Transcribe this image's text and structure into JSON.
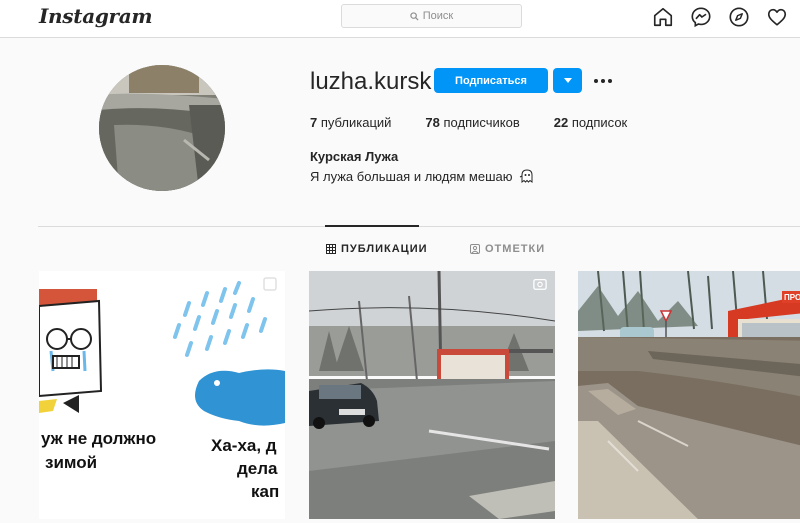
{
  "header": {
    "logo": "Instagram",
    "search_placeholder": "Поиск",
    "icons": [
      "home-icon",
      "messenger-icon",
      "explore-icon",
      "heart-icon"
    ]
  },
  "profile": {
    "username": "luzha.kursk",
    "follow_label": "Подписаться",
    "posts_count": "7",
    "posts_label": " публикаций",
    "followers_count": "78",
    "followers_label": " подписчиков",
    "following_count": "22",
    "following_label": " подписок",
    "full_name": "Курская Лужа",
    "bio": "Я лужа большая и людям мешаю"
  },
  "tabs": [
    {
      "label": "ПУБЛИКАЦИИ",
      "active": true
    },
    {
      "label": "ОТМЕТКИ",
      "active": false
    }
  ],
  "posts": [
    {
      "caption_line1": "уж не должно",
      "caption_line2": "зимой",
      "caption_right1": "Ха-ха, д",
      "caption_right2": "дела",
      "caption_right3": "кап",
      "badge": "multiple-icon"
    },
    {
      "badge": "video-icon"
    },
    {
      "kiosk_sign": "ПРОДУК"
    }
  ],
  "colors": {
    "accent": "#0095f6",
    "border": "#dbdbdb",
    "muted": "#8e8e8e"
  }
}
